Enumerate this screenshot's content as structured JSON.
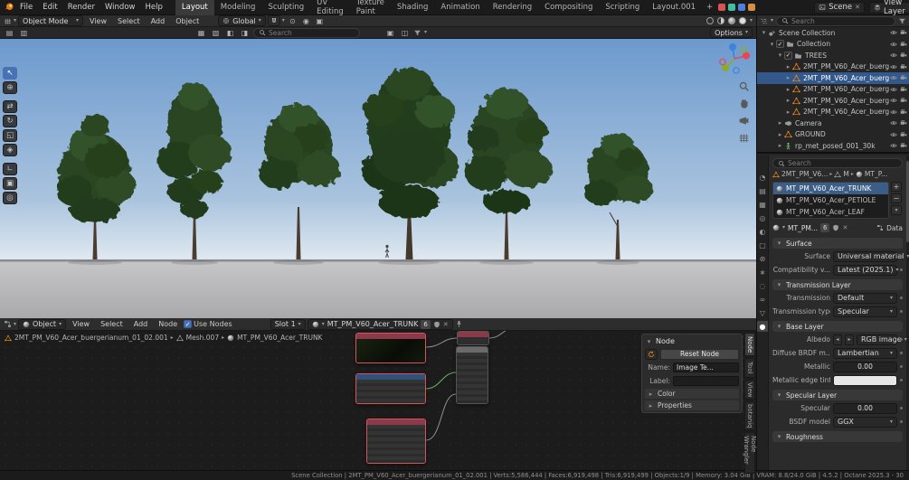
{
  "topbar": {
    "menus": [
      "File",
      "Edit",
      "Render",
      "Window",
      "Help"
    ],
    "workspaces": [
      "Layout",
      "Modeling",
      "Sculpting",
      "UV Editing",
      "Texture Paint",
      "Shading",
      "Animation",
      "Rendering",
      "Compositing",
      "Scripting",
      "Layout.001"
    ],
    "add_workspace": "+",
    "scene_label": "Scene",
    "view_layer_label": "View Layer"
  },
  "viewport": {
    "mode": "Object Mode",
    "menus": [
      "View",
      "Select",
      "Add",
      "Object"
    ],
    "orientation": "Global",
    "search_placeholder": "Search",
    "options_label": "Options"
  },
  "node_editor": {
    "mode": "Object",
    "menus": [
      "View",
      "Select",
      "Add",
      "Node"
    ],
    "use_nodes_label": "Use Nodes",
    "slot_label": "Slot 1",
    "material_name": "MT_PM_V60_Acer_TRUNK",
    "material_users": "6",
    "breadcrumb": {
      "object": "2MT_PM_V60_Acer_buergerianum_01_02.001",
      "mesh": "Mesh.007",
      "material": "MT_PM_V60_Acer_TRUNK"
    },
    "sidebar": {
      "panel_title": "Node",
      "reset_button": "Reset Node",
      "name_label": "Name:",
      "name_value": "Image Te...",
      "label_label": "Label:",
      "label_value": "",
      "color_section": "Color",
      "properties_section": "Properties"
    },
    "tabs": [
      "Node",
      "Tool",
      "View",
      "botaniq",
      "Node Wrangler"
    ]
  },
  "outliner": {
    "search_placeholder": "Search",
    "rows": [
      {
        "label": "Scene Collection"
      },
      {
        "label": "Collection"
      },
      {
        "label": "TREES"
      },
      {
        "label": "2MT_PM_V60_Acer_buerg"
      },
      {
        "label": "2MT_PM_V60_Acer_buerg"
      },
      {
        "label": "2MT_PM_V60_Acer_buerg"
      },
      {
        "label": "2MT_PM_V60_Acer_buerg"
      },
      {
        "label": "2MT_PM_V60_Acer_buerg"
      },
      {
        "label": "Camera"
      },
      {
        "label": "GROUND"
      },
      {
        "label": "rp_met_posed_001_30k"
      }
    ]
  },
  "properties": {
    "search_placeholder": "Search",
    "breadcrumb": {
      "object": "2MT_PM_V6...",
      "mesh": "M",
      "material": "MT_P..."
    },
    "slots": [
      "MT_PM_V60_Acer_TRUNK",
      "MT_PM_V60_Acer_PETIOLE",
      "MT_PM_V60_Acer_LEAF"
    ],
    "datablock": {
      "name": "MT_PM...",
      "users": "6",
      "data_label": "Data"
    },
    "sections": {
      "surface": "Surface",
      "transmission_layer": "Transmission Layer",
      "base_layer": "Base Layer",
      "specular_layer": "Specular Layer",
      "roughness": "Roughness"
    },
    "rows": {
      "surface": {
        "label": "Surface",
        "value": "Universal material"
      },
      "compatibility": {
        "label": "Compatibility v...",
        "value": "Latest (2025.1)"
      },
      "transmission": {
        "label": "Transmission",
        "value": "Default"
      },
      "transmission_type": {
        "label": "Transmission type",
        "value": "Specular"
      },
      "albedo": {
        "label": "Albedo",
        "value": "RGB image"
      },
      "diffuse_brdf": {
        "label": "Diffuse BRDF m...",
        "value": "Lambertian"
      },
      "metallic": {
        "label": "Metallic",
        "value": "0.00"
      },
      "edge_tint": {
        "label": "Metallic edge tint"
      },
      "specular": {
        "label": "Specular",
        "value": "0.00"
      },
      "bsdf_model": {
        "label": "BSDF model",
        "value": "GGX"
      }
    }
  },
  "statusbar": {
    "text": "Scene Collection | 2MT_PM_V60_Acer_buergerianum_01_02.001 | Verts:5,586,444 | Faces:6,919,498 | Tris:6,919,499 | Objects:1/9 | Memory: 3.04 GiB | VRAM: 8.8/24.0 GiB | 4.5.2 | Octane 2025.3 - 30"
  }
}
